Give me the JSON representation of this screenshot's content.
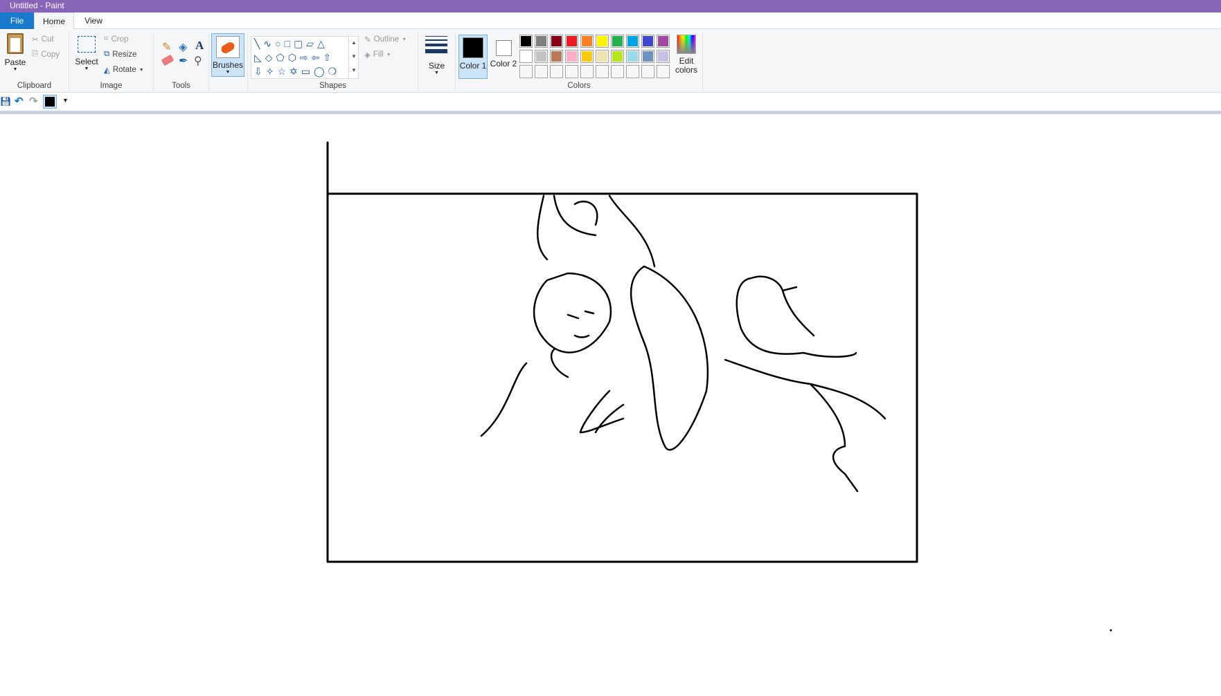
{
  "window": {
    "title": "Untitled - Paint"
  },
  "tabs": [
    {
      "label": "File"
    },
    {
      "label": "Home"
    },
    {
      "label": "View"
    }
  ],
  "clipboard": {
    "paste": "Paste",
    "cut": "Cut",
    "copy": "Copy",
    "group": "Clipboard"
  },
  "image": {
    "select": "Select",
    "crop": "Crop",
    "resize": "Resize",
    "rotate": "Rotate",
    "group": "Image"
  },
  "tools": {
    "group": "Tools"
  },
  "brushes": {
    "label": "Brushes"
  },
  "shapes": {
    "outline": "Outline",
    "fill": "Fill",
    "group": "Shapes"
  },
  "size": {
    "label": "Size"
  },
  "colors": {
    "color1": "Color 1",
    "color2": "Color 2",
    "edit": "Edit colors",
    "group": "Colors",
    "color1_value": "#000000",
    "color2_value": "#ffffff",
    "palette_row1": [
      "#000000",
      "#7f7f7f",
      "#880015",
      "#ed1c24",
      "#ff7f27",
      "#fff200",
      "#22b14c",
      "#00a2e8",
      "#3f48cc",
      "#a349a4"
    ],
    "palette_row2": [
      "#ffffff",
      "#c3c3c3",
      "#b97a57",
      "#ffaec9",
      "#ffc90e",
      "#efe4b0",
      "#b5e61d",
      "#99d9ea",
      "#7092be",
      "#c8bfe7"
    ]
  },
  "accent": "#8764b8"
}
